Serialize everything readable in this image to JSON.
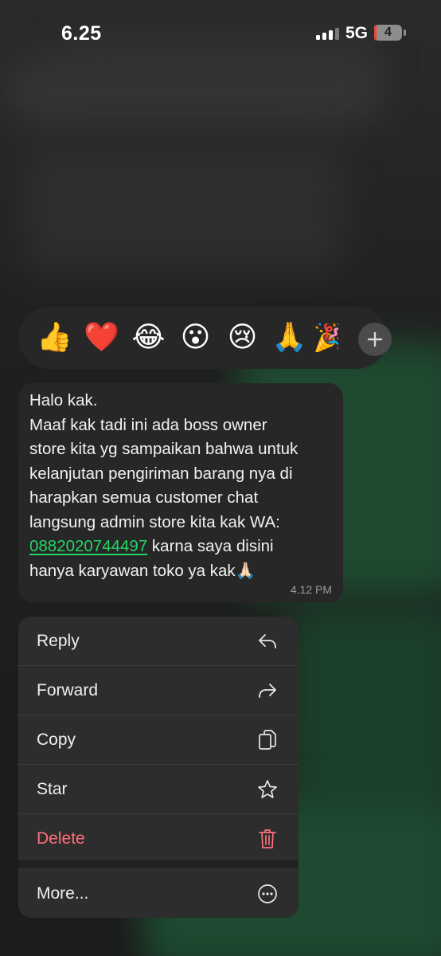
{
  "status_bar": {
    "time": "6.25",
    "network": "5G",
    "battery": "4"
  },
  "reactions": {
    "emojis": [
      "👍",
      "❤️",
      "😂",
      "😮",
      "😢",
      "🙏",
      "🎉"
    ],
    "add_icon": "plus-icon"
  },
  "message": {
    "line1": "Halo kak.",
    "line2": "Maaf kak tadi ini ada boss owner",
    "line3": "store kita yg sampaikan bahwa untuk",
    "line4": "kelanjutan pengiriman barang nya di",
    "line5": "harapkan semua customer chat",
    "line6": "langsung admin store kita kak WA:",
    "phone": "0882020744497",
    "line7_rest": " karna saya disini",
    "line8": "hanya karyawan toko ya kak🙏🏻",
    "time": "4.12 PM"
  },
  "menu": {
    "reply": "Reply",
    "forward": "Forward",
    "copy": "Copy",
    "star": "Star",
    "delete": "Delete",
    "more": "More..."
  },
  "colors": {
    "link": "#25d366",
    "delete": "#ff6f7a",
    "bubble": "#262726",
    "menu": "#2c2d2c"
  }
}
